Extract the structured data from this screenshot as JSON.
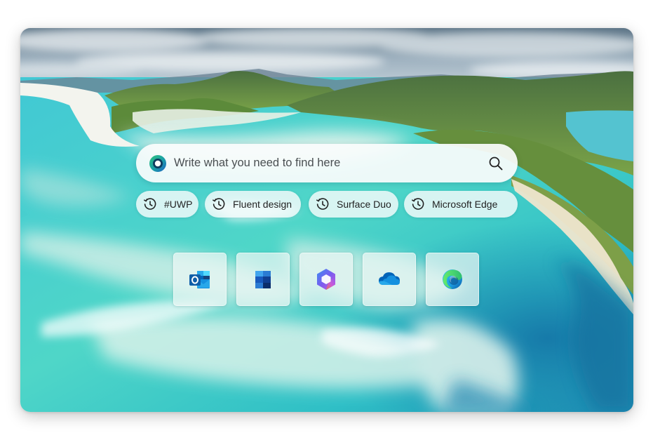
{
  "search": {
    "placeholder": "Write what you need to find here"
  },
  "chips": [
    {
      "label": "#UWP"
    },
    {
      "label": "Fluent design"
    },
    {
      "label": "Surface Duo"
    },
    {
      "label": "Microsoft Edge"
    }
  ],
  "apps": [
    {
      "name": "Outlook",
      "icon": "outlook-icon"
    },
    {
      "name": "Microsoft To Do / Office",
      "icon": "office-blocks-icon"
    },
    {
      "name": "Microsoft 365",
      "icon": "microsoft-365-icon"
    },
    {
      "name": "OneDrive",
      "icon": "onedrive-icon"
    },
    {
      "name": "Microsoft Edge",
      "icon": "edge-icon"
    }
  ],
  "colors": {
    "accent": "#0f6cbd",
    "water": "#38c9c6",
    "sand": "#e9efe4",
    "hills": "#5f8a3c"
  }
}
